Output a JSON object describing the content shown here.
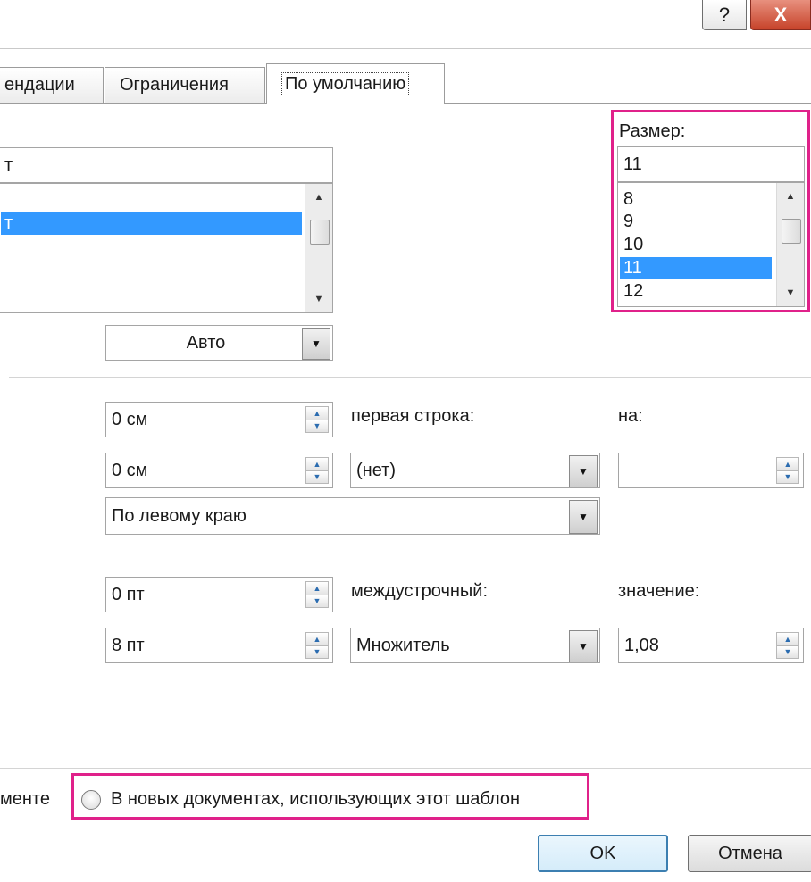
{
  "window": {
    "help_label": "?",
    "close_label": "X"
  },
  "tabs": [
    {
      "label": "ендации"
    },
    {
      "label": "Ограничения"
    },
    {
      "label": "По умолчанию"
    }
  ],
  "font": {
    "name_value": "т",
    "list_items": [
      "т"
    ],
    "color_value": "Авто"
  },
  "size": {
    "label": "Размер:",
    "value": "11",
    "options": [
      "8",
      "9",
      "10",
      "11",
      "12"
    ],
    "selected": "11"
  },
  "indent": {
    "left_value": "0 см",
    "right_value": "0 см",
    "first_line_label": "первая строка:",
    "first_line_value": "(нет)",
    "by_label": "на:",
    "by_value": "",
    "alignment_value": "По левому краю"
  },
  "spacing": {
    "before_value": "0 пт",
    "after_value": "8 пт",
    "line_label": "междустрочный:",
    "line_value": "Множитель",
    "value_label": "значение:",
    "value_value": "1,08"
  },
  "apply_to": {
    "current_doc_label": "менте",
    "template_label": "В новых документах, использующих этот шаблон"
  },
  "buttons": {
    "ok": "OK",
    "cancel": "Отмена"
  },
  "colors": {
    "highlight": "#e0218a",
    "selection": "#3399ff"
  }
}
